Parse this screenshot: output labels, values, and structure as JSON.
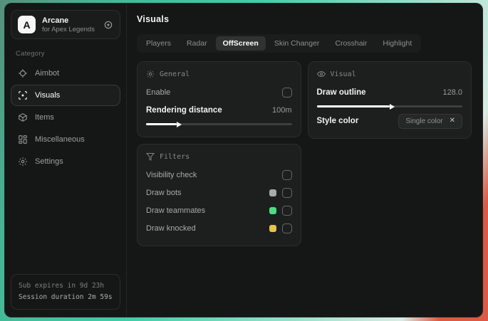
{
  "app": {
    "logo_letter": "A",
    "title": "Arcane",
    "subtitle": "for Apex Legends"
  },
  "sidebar": {
    "category_label": "Category",
    "items": [
      {
        "label": "Aimbot"
      },
      {
        "label": "Visuals"
      },
      {
        "label": "Items"
      },
      {
        "label": "Miscellaneous"
      },
      {
        "label": "Settings"
      }
    ],
    "footer": {
      "sub_expires": "Sub expires in 9d 23h",
      "session_duration": "Session duration 2m 59s"
    }
  },
  "main": {
    "title": "Visuals",
    "active_tab": "OffScreen",
    "tabs": [
      {
        "label": "Players"
      },
      {
        "label": "Radar"
      },
      {
        "label": "OffScreen"
      },
      {
        "label": "Skin Changer"
      },
      {
        "label": "Crosshair"
      },
      {
        "label": "Highlight"
      }
    ]
  },
  "panels": {
    "general": {
      "title": "General",
      "enable_label": "Enable",
      "enable_checked": false,
      "rendering_distance_label": "Rendering distance",
      "rendering_distance_value": "100m",
      "rendering_distance_percent": 21
    },
    "visual": {
      "title": "Visual",
      "draw_outline_label": "Draw outline",
      "draw_outline_value": "128.0",
      "draw_outline_percent": 50,
      "style_color_label": "Style color",
      "style_color_value": "Single color",
      "style_color_clear": "✕"
    },
    "filters": {
      "title": "Filters",
      "rows": [
        {
          "label": "Visibility check",
          "checked": false
        },
        {
          "label": "Draw bots",
          "swatch": "#aaaaaa",
          "checked": false
        },
        {
          "label": "Draw teammates",
          "swatch": "#4ade80",
          "checked": false
        },
        {
          "label": "Draw knocked",
          "swatch": "#e7c24c",
          "checked": false
        }
      ]
    }
  },
  "colors": {
    "desktop_teal": "#42cda8",
    "desktop_red": "#dc5a45",
    "swatch_gray": "#aaaaaa",
    "swatch_green": "#4ade80",
    "swatch_yellow": "#e7c24c"
  }
}
